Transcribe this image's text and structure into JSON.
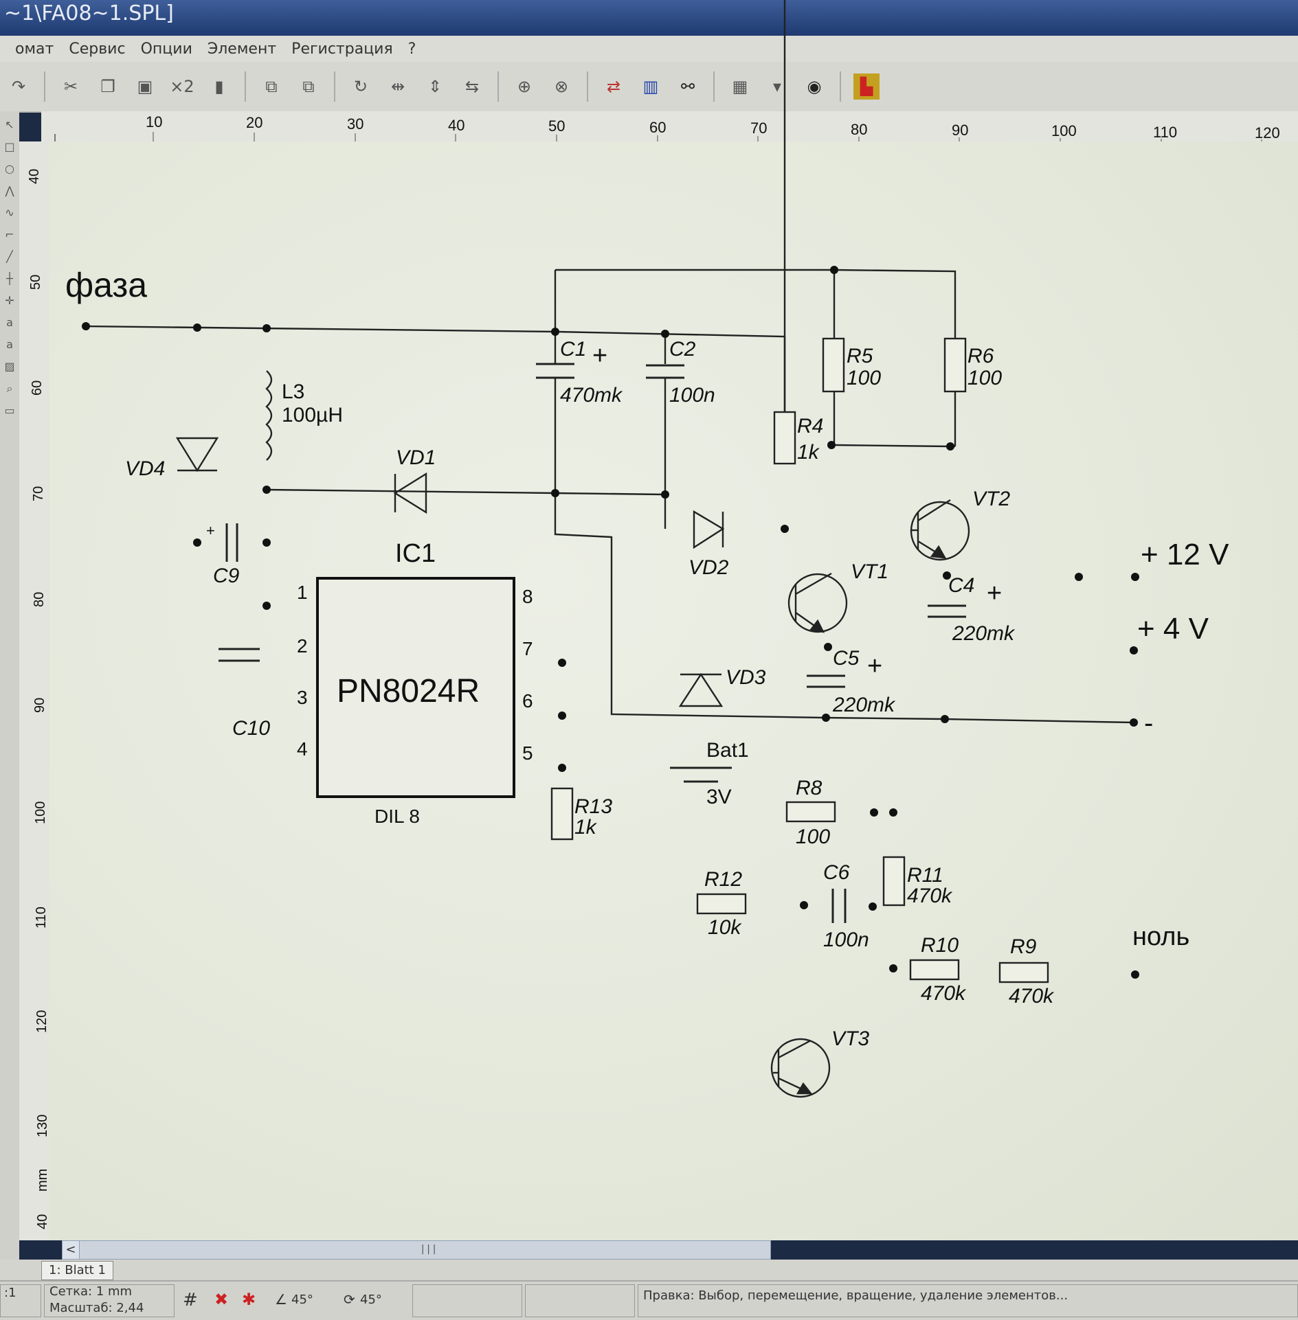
{
  "window": {
    "title": "~1\\FA08~1.SPL]"
  },
  "menu": [
    "омат",
    "Сервис",
    "Опции",
    "Элемент",
    "Регистрация",
    "?"
  ],
  "toolbar": {
    "duplicate_label": "×2"
  },
  "ruler": {
    "top": [
      "10",
      "20",
      "30",
      "40",
      "50",
      "60",
      "70",
      "80",
      "90",
      "100",
      "110",
      "120"
    ],
    "left": [
      "40",
      "50",
      "60",
      "70",
      "80",
      "90",
      "100",
      "110",
      "120",
      "130",
      "40"
    ],
    "unit": "mm"
  },
  "schematic": {
    "phase": "фаза",
    "neutral": "ноль",
    "out_12v": "+ 12 V",
    "out_4v": "+ 4 V",
    "out_minus": "-",
    "ic": {
      "ref": "IC1",
      "part": "PN8024R",
      "package": "DIL 8",
      "pins": [
        "1",
        "2",
        "3",
        "4",
        "5",
        "6",
        "7",
        "8"
      ]
    },
    "components": {
      "C1": {
        "ref": "C1",
        "value": "470mk"
      },
      "C2": {
        "ref": "C2",
        "value": "100n"
      },
      "C4": {
        "ref": "C4",
        "value": "220mk"
      },
      "C5": {
        "ref": "C5",
        "value": "220mk"
      },
      "C6": {
        "ref": "C6",
        "value": "100n"
      },
      "C9": {
        "ref": "C9"
      },
      "C10": {
        "ref": "C10"
      },
      "L3": {
        "ref": "L3",
        "value": "100µH"
      },
      "R4": {
        "ref": "R4",
        "value": "1k"
      },
      "R5": {
        "ref": "R5",
        "value": "100"
      },
      "R6": {
        "ref": "R6",
        "value": "100"
      },
      "R8": {
        "ref": "R8",
        "value": "100"
      },
      "R9": {
        "ref": "R9",
        "value": "470k"
      },
      "R10": {
        "ref": "R10",
        "value": "470k"
      },
      "R11": {
        "ref": "R11",
        "value": "470k"
      },
      "R12": {
        "ref": "R12",
        "value": "10k"
      },
      "R13": {
        "ref": "R13",
        "value": "1k"
      },
      "VD1": {
        "ref": "VD1"
      },
      "VD2": {
        "ref": "VD2"
      },
      "VD3": {
        "ref": "VD3"
      },
      "VD4": {
        "ref": "VD4"
      },
      "VT1": {
        "ref": "VT1"
      },
      "VT2": {
        "ref": "VT2"
      },
      "VT3": {
        "ref": "VT3"
      },
      "Bat1": {
        "ref": "Bat1",
        "value": "3V"
      }
    },
    "plus_sign": "+"
  },
  "sheet_tab": "1: Blatt 1",
  "status": {
    "scale_left": ":1",
    "grid": "Сетка: 1 mm",
    "zoom": "Масштаб:  2,44",
    "angle1": "45°",
    "angle2": "45°",
    "hint": "Правка: Выбор, перемещение, вращение, удаление элементов..."
  }
}
